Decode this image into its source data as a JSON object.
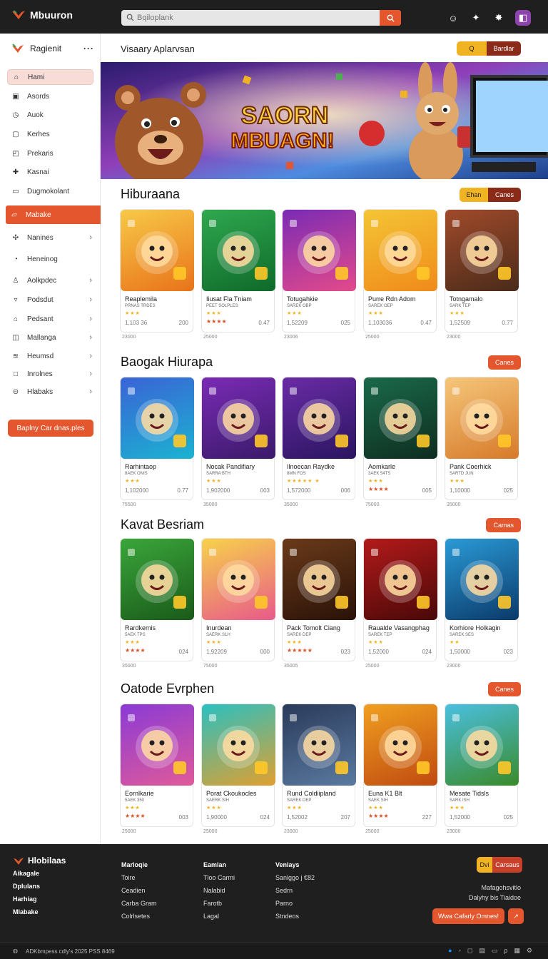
{
  "app": {
    "name": "Mbuuron",
    "search_placeholder": "Bqiloplank"
  },
  "sidebar": {
    "header": "Ragienit",
    "items": [
      {
        "label": "Hami",
        "icon": "home-icon"
      },
      {
        "label": "Asords",
        "icon": "grid-icon"
      },
      {
        "label": "Auok",
        "icon": "clock-icon"
      },
      {
        "label": "Kerhes",
        "icon": "box-icon"
      },
      {
        "label": "Prekaris",
        "icon": "bag-icon"
      },
      {
        "label": "Kasnai",
        "icon": "puzzle-icon"
      },
      {
        "label": "Dugmokolant",
        "icon": "card-icon"
      },
      {
        "label": "Mabake",
        "icon": "folder-icon"
      },
      {
        "label": "Nanines",
        "icon": "star-icon"
      },
      {
        "label": "Heneinog",
        "icon": "bell-icon"
      },
      {
        "label": "Aolkpdec",
        "icon": "user-icon"
      },
      {
        "label": "Podsdut",
        "icon": "cart-icon"
      },
      {
        "label": "Pedsant",
        "icon": "house-icon"
      },
      {
        "label": "Mallanga",
        "icon": "tray-icon"
      },
      {
        "label": "Heumsd",
        "icon": "layers-icon"
      },
      {
        "label": "Inrolnes",
        "icon": "square-icon"
      },
      {
        "label": "Hlabaks",
        "icon": "circle-chevron-icon"
      }
    ],
    "cta": "Baplny Car dnas.ples"
  },
  "main": {
    "title": "Visaary Aplarvsan",
    "btn_a": "Q",
    "btn_b": "Bardlar",
    "banner_text_1": "SAORN",
    "banner_text_2": "MBUAGN!"
  },
  "sections": [
    {
      "title": "Hiburaana",
      "btn_a": "Ehan",
      "btn_b": "Canes",
      "cards": [
        {
          "name": "Reaplemila",
          "sub": "PRNAS TRDES",
          "stars": "★★★",
          "stars2": "",
          "dl": "1,103 36",
          "rating": "200",
          "price": "23000"
        },
        {
          "name": "Iiusat Fla Tniam",
          "sub": "PEET SOLPLES",
          "stars": "★★★",
          "stars2": "★★★★",
          "dl": "",
          "rating": "0.47",
          "price": "25000"
        },
        {
          "name": "Totugahkie",
          "sub": "SAREK OBP",
          "stars": "★★★",
          "stars2": "",
          "dl": "1,52209",
          "rating": "025",
          "price": "23006"
        },
        {
          "name": "Purre Rdn Adom",
          "sub": "SAREK OEP",
          "stars": "★★★",
          "stars2": "",
          "dl": "1,103036",
          "rating": "0.47",
          "price": "25000"
        },
        {
          "name": "Totngamalo",
          "sub": "SARK TEP",
          "stars": "★★★",
          "stars2": "",
          "dl": "1,52509",
          "rating": "0.77",
          "price": "23000"
        }
      ]
    },
    {
      "title": "Baogak Hiurapa",
      "btn_a": "",
      "btn_b": "Canes",
      "cards": [
        {
          "name": "Rarhintaop",
          "sub": "8AEK ONIS",
          "stars": "★★★",
          "stars2": "",
          "dl": "1,102000",
          "rating": "0.77",
          "price": "75500"
        },
        {
          "name": "Nocak Pandifiary",
          "sub": "SARRA BTH",
          "stars": "★★★",
          "stars2": "",
          "dl": "1,902000",
          "rating": "003",
          "price": "35000"
        },
        {
          "name": "Ilnoecan Raydke",
          "sub": "8MN FOS",
          "stars": "★★★★★ ★",
          "stars2": "",
          "dl": "1,572000",
          "rating": "006",
          "price": "35000"
        },
        {
          "name": "Aomkarle",
          "sub": "3AEK 54TS",
          "stars": "★★★",
          "stars2": "★★★★",
          "dl": "",
          "rating": "005",
          "price": "75000"
        },
        {
          "name": "Pank Coerhick",
          "sub": "SARTD JUN",
          "stars": "★★★",
          "stars2": "",
          "dl": "1,10000",
          "rating": "025",
          "price": "35000"
        }
      ]
    },
    {
      "title": "Kavat Besriam",
      "btn_a": "",
      "btn_b": "Camas",
      "cards": [
        {
          "name": "Rardkemis",
          "sub": "5AEK TPS",
          "stars": "★★★",
          "stars2": "★★★★",
          "dl": "",
          "rating": "024",
          "price": "35000"
        },
        {
          "name": "Inurdean",
          "sub": "SAERK S1H",
          "stars": "★★★",
          "stars2": "",
          "dl": "1,92209",
          "rating": "000",
          "price": "75000"
        },
        {
          "name": "Pack Tomolt Ciang",
          "sub": "SAREK DEP",
          "stars": "★★★",
          "stars2": "★★★★★",
          "dl": "",
          "rating": "023",
          "price": "35005"
        },
        {
          "name": "Raualde Vasangphag",
          "sub": "SAREK TEP",
          "stars": "★★★",
          "stars2": "",
          "dl": "1,52000",
          "rating": "024",
          "price": "25000"
        },
        {
          "name": "Korhiore Holkagin",
          "sub": "SAREK SES",
          "stars": "★★",
          "stars2": "",
          "dl": "1,50000",
          "rating": "023",
          "price": "23000"
        }
      ]
    },
    {
      "title": "Oatode Evrphen",
      "btn_a": "",
      "btn_b": "Canes",
      "cards": [
        {
          "name": "Eornlkarie",
          "sub": "5AEK 350",
          "stars": "★★★",
          "stars2": "★★★★",
          "dl": "",
          "rating": "003",
          "price": "25000"
        },
        {
          "name": "Porat Ckoukocles",
          "sub": "SAERK SIH",
          "stars": "★★★",
          "stars2": "",
          "dl": "1,90000",
          "rating": "024",
          "price": "25000"
        },
        {
          "name": "Rund Coldiipland",
          "sub": "SAREK DEP",
          "stars": "★★★",
          "stars2": "",
          "dl": "1,52002",
          "rating": "207",
          "price": "23000"
        },
        {
          "name": "Euna K1 Blt",
          "sub": "SAEK SIH",
          "stars": "★★★",
          "stars2": "★★★★",
          "dl": "",
          "rating": "227",
          "price": "25000"
        },
        {
          "name": "Mesate Tidsls",
          "sub": "SARK ISH",
          "stars": "★★★",
          "stars2": "",
          "dl": "1,52000",
          "rating": "025",
          "price": "23000"
        }
      ]
    }
  ],
  "footer": {
    "brand": "Hlobilaas",
    "brand_links": [
      "Aikagale",
      "Dplulans",
      "Harhiag",
      "Mlabake"
    ],
    "col1": {
      "head": "Marloqie",
      "links": [
        "Toire",
        "Ceadien",
        "Carba Gram",
        "Colrlsetes"
      ]
    },
    "col2": {
      "head": "Eamlan",
      "links": [
        "Tloo Carmi",
        "Nalabid",
        "Farotb",
        "Lagal"
      ]
    },
    "col3": {
      "head": "Venlays",
      "links": [
        "Sanlggo j €82",
        "Sedrn",
        "Parno",
        "Stndeos"
      ]
    },
    "btn_a": "Dvi",
    "btn_b": "Carsaus",
    "text_1": "Mafagohsvitlo",
    "text_2": "Dalyhy bis Tiaidoe",
    "cta": "Wwa Cafarly Omnes!",
    "copyright": "ADKbmpess cdly's 2025 PSS 8469"
  },
  "colors": {
    "accent": "#e4572e",
    "yellow": "#f0b323",
    "dark": "#1f1f1f"
  }
}
